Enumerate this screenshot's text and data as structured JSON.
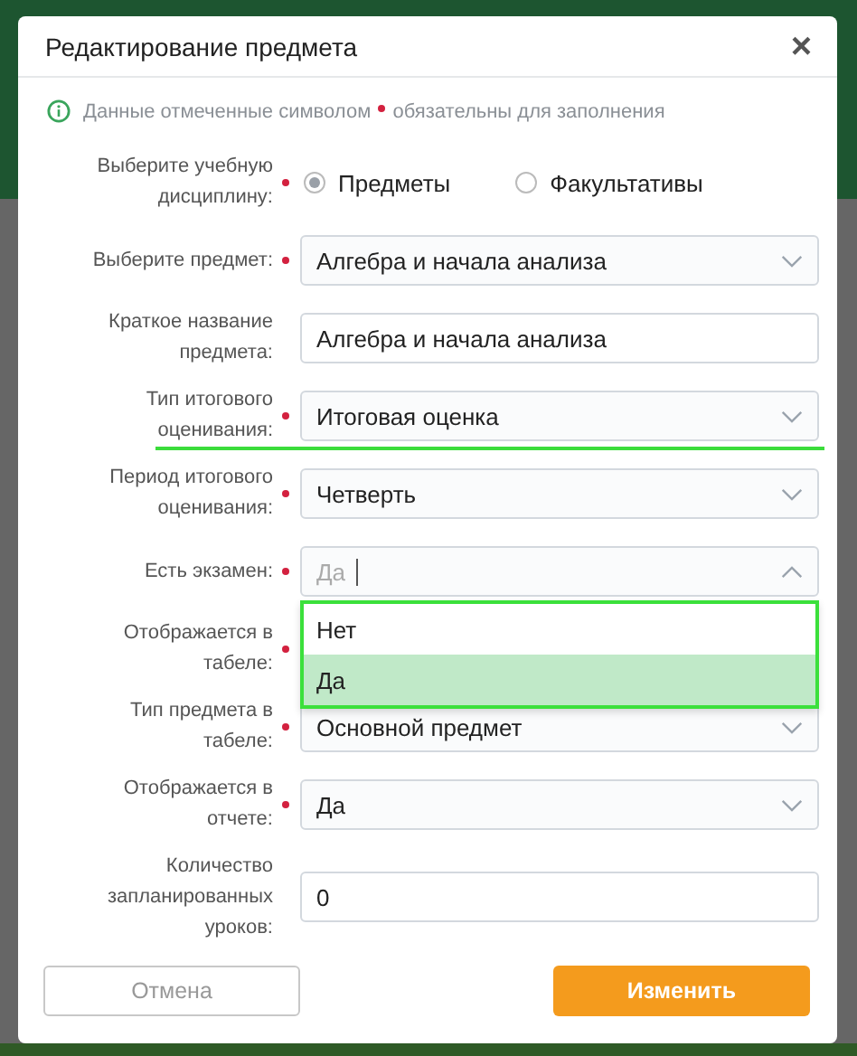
{
  "dialog": {
    "title": "Редактирование предмета",
    "close": "×"
  },
  "note": {
    "before": "Данные отмеченные символом",
    "after": "обязательны для заполнения"
  },
  "fields": [
    {
      "kind": "radio",
      "label": "Выберите учебную дисциплину:",
      "required": true,
      "options": [
        {
          "label": "Предметы",
          "selected": true
        },
        {
          "label": "Факультативы",
          "selected": false
        }
      ]
    },
    {
      "kind": "select",
      "label": "Выберите предмет:",
      "required": true,
      "value": "Алгебра и начала анализа"
    },
    {
      "kind": "input",
      "label": "Краткое название предмета:",
      "required": false,
      "value": "Алгебра и начала анализа"
    },
    {
      "kind": "select",
      "label": "Тип итогового оценивания:",
      "required": true,
      "value": "Итоговая оценка",
      "underlined": true
    },
    {
      "kind": "select",
      "label": "Период итогового оценивания:",
      "required": true,
      "value": "Четверть"
    },
    {
      "kind": "select",
      "label": "Есть экзамен:",
      "required": true,
      "placeholder": "Да",
      "expanded": true,
      "highlighted": true,
      "options": [
        {
          "label": "Нет",
          "selected": false
        },
        {
          "label": "Да",
          "selected": true
        }
      ]
    },
    {
      "kind": "select",
      "label": "Отображается в табеле:",
      "required": true
    },
    {
      "kind": "select",
      "label": "Тип предмета в табеле:",
      "required": true,
      "value": "Основной предмет"
    },
    {
      "kind": "select",
      "label": "Отображается в отчете:",
      "required": true,
      "value": "Да"
    },
    {
      "kind": "input",
      "label": "Количество запланированных уроков:",
      "required": false,
      "value": "0"
    }
  ],
  "buttons": {
    "cancel": "Отмена",
    "submit": "Изменить"
  }
}
